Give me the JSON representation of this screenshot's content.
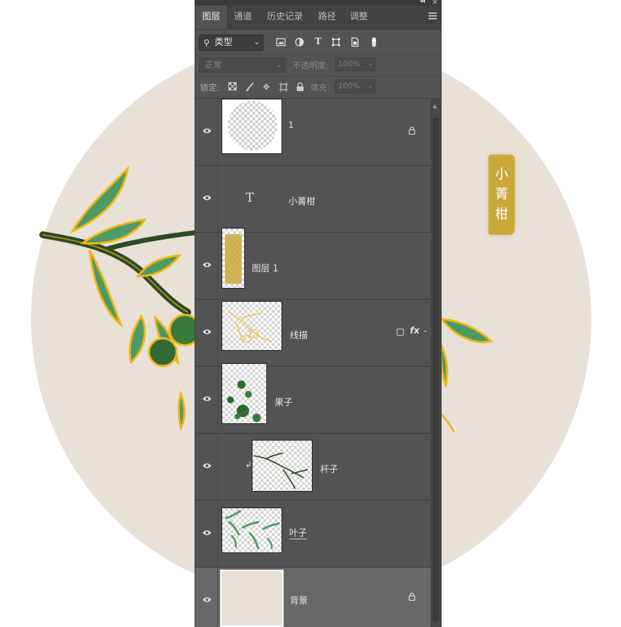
{
  "canvas": {
    "background_color": "#ffffff",
    "circle_color": "#e8e1d8",
    "badge_text": "小\n菁\n柑",
    "badge_color": "#c9a93a"
  },
  "panel": {
    "tabs": [
      {
        "label": "图层",
        "active": true
      },
      {
        "label": "通道",
        "active": false
      },
      {
        "label": "历史记录",
        "active": false
      },
      {
        "label": "路径",
        "active": false
      },
      {
        "label": "调整",
        "active": false
      }
    ],
    "filter": {
      "kind_label": "类型",
      "icons": [
        "image-filter-icon",
        "adjustment-filter-icon",
        "type-filter-icon",
        "shape-filter-icon",
        "smart-object-filter-icon",
        "filter-toggle-icon"
      ]
    },
    "blend": {
      "mode": "正常",
      "opacity_label": "不透明度:",
      "opacity_value": "100%"
    },
    "lock": {
      "label": "锁定:",
      "icons": [
        "lock-transparent-icon",
        "lock-paint-icon",
        "lock-position-icon",
        "lock-artboard-icon",
        "lock-all-icon"
      ],
      "fill_label": "填充:",
      "fill_value": "100%"
    },
    "layers": [
      {
        "name": "1",
        "type": "mask",
        "locked": true,
        "selected": false
      },
      {
        "name": "小菁柑",
        "type": "text",
        "locked": false,
        "selected": false
      },
      {
        "name": "图层 1",
        "type": "pixel",
        "locked": false,
        "selected": false
      },
      {
        "name": "线描",
        "type": "pixel",
        "locked": false,
        "selected": false,
        "fx": "fx"
      },
      {
        "name": "果子",
        "type": "pixel",
        "locked": false,
        "selected": false
      },
      {
        "name": "杆子",
        "type": "pixel",
        "locked": false,
        "selected": false,
        "clipped": true
      },
      {
        "name": "叶子",
        "type": "pixel",
        "locked": false,
        "selected": false
      },
      {
        "name": "背景",
        "type": "background",
        "locked": true,
        "selected": true
      }
    ]
  }
}
